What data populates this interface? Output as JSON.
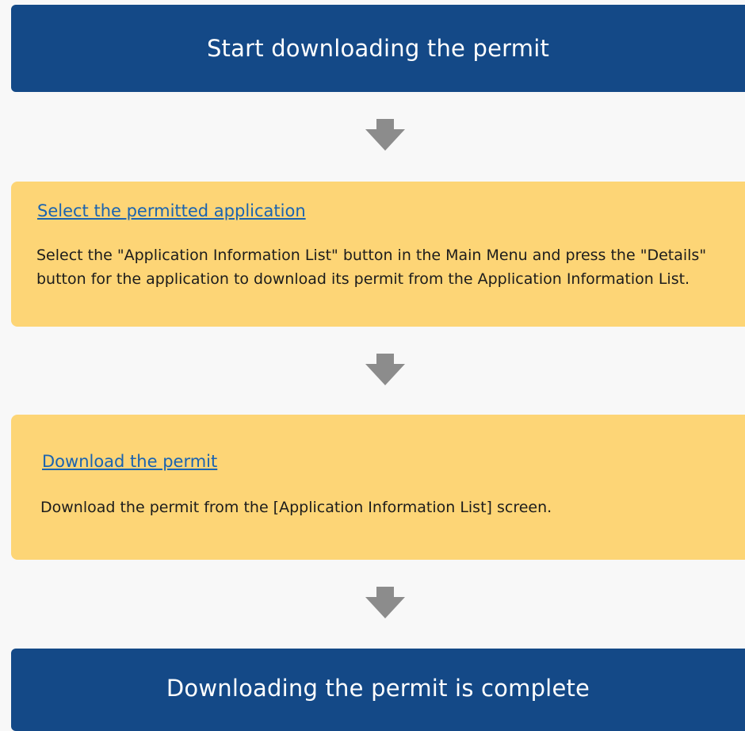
{
  "flow": {
    "start": "Start downloading the permit",
    "steps": [
      {
        "title": "Select the permitted application",
        "description": "Select the \"Application Information List\" button in the Main Menu and press the \"Details\" button for the application to download its permit from the Application Information List."
      },
      {
        "title": "Download the permit",
        "description": "Download the permit from the [Application Information List] screen."
      }
    ],
    "end": "Downloading the permit is complete"
  },
  "colors": {
    "banner": "#144987",
    "step_box": "#fdd576",
    "link": "#1a63b0",
    "arrow": "#8c8c8c",
    "background": "#f8f8f8"
  },
  "icons": {
    "arrow": "arrow-down-icon"
  }
}
